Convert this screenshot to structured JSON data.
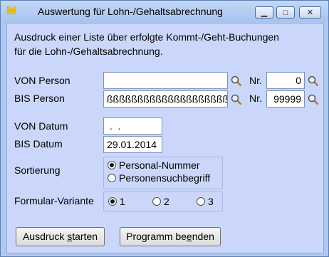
{
  "window": {
    "title": "Auswertung für Lohn-/Gehaltsabrechnung",
    "app_icon_glyph": "M"
  },
  "description": {
    "line1": "Ausdruck einer Liste über erfolgte Kommt-/Geht-Buchungen",
    "line2": "für die Lohn-/Gehaltsabrechnung."
  },
  "von_person": {
    "label": "VON Person",
    "value": "",
    "nr_label": "Nr.",
    "nr_value": "0"
  },
  "bis_person": {
    "label": "BIS Person",
    "value": "ßßßßßßßßßßßßßßßßßßßß",
    "nr_label": "Nr.",
    "nr_value": "99999"
  },
  "von_datum": {
    "label": "VON Datum",
    "value": " .  ."
  },
  "bis_datum": {
    "label": "BIS Datum",
    "value": "29.01.2014"
  },
  "sortierung": {
    "label": "Sortierung",
    "options": [
      "Personal-Nummer",
      "Personensuchbegriff"
    ],
    "selected": "Personal-Nummer"
  },
  "formular": {
    "label": "Formular-Variante",
    "options": [
      "1",
      "2",
      "3"
    ],
    "selected": "1"
  },
  "buttons": {
    "start_pre": "Ausdruck ",
    "start_u": "s",
    "start_post": "tarten",
    "end_pre": "Programm be",
    "end_u": "e",
    "end_post": "nden"
  },
  "icons": {
    "search": "magnifier-icon",
    "minimize": "minimize-icon",
    "maximize": "maximize-icon",
    "close": "close-icon"
  }
}
